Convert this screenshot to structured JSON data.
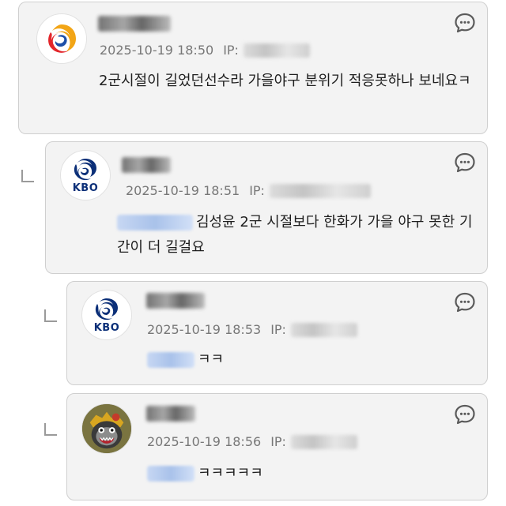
{
  "comments": [
    {
      "avatar": "kbo-swirl-logo",
      "timestamp": "2025-10-19 18:50",
      "ip_label": "IP:",
      "text": "2군시절이 길었던선수라 가을야구 분위기 적응못하나 보네요ㅋ",
      "reply_icon": "speech-bubble-icon"
    },
    {
      "avatar": "kbo-logo",
      "avatar_text": "KBO",
      "timestamp": "2025-10-19 18:51",
      "ip_label": "IP:",
      "text": "김성윤 2군 시절보다 한화가 가을 야구 못한 기간이 더 길걸요",
      "reply_icon": "speech-bubble-icon"
    },
    {
      "avatar": "kbo-logo",
      "avatar_text": "KBO",
      "timestamp": "2025-10-19 18:53",
      "ip_label": "IP:",
      "text": "ㅋㅋ",
      "reply_icon": "speech-bubble-icon"
    },
    {
      "avatar": "gorilla-character",
      "timestamp": "2025-10-19 18:56",
      "ip_label": "IP:",
      "text": "ㅋㅋㅋㅋㅋ",
      "reply_icon": "speech-bubble-icon"
    }
  ],
  "colors": {
    "card_bg": "#f3f3f3",
    "card_border": "#cfcfcf",
    "meta_text": "#777777",
    "body_text": "#1e1e1e",
    "kbo_navy": "#0b2f78"
  }
}
